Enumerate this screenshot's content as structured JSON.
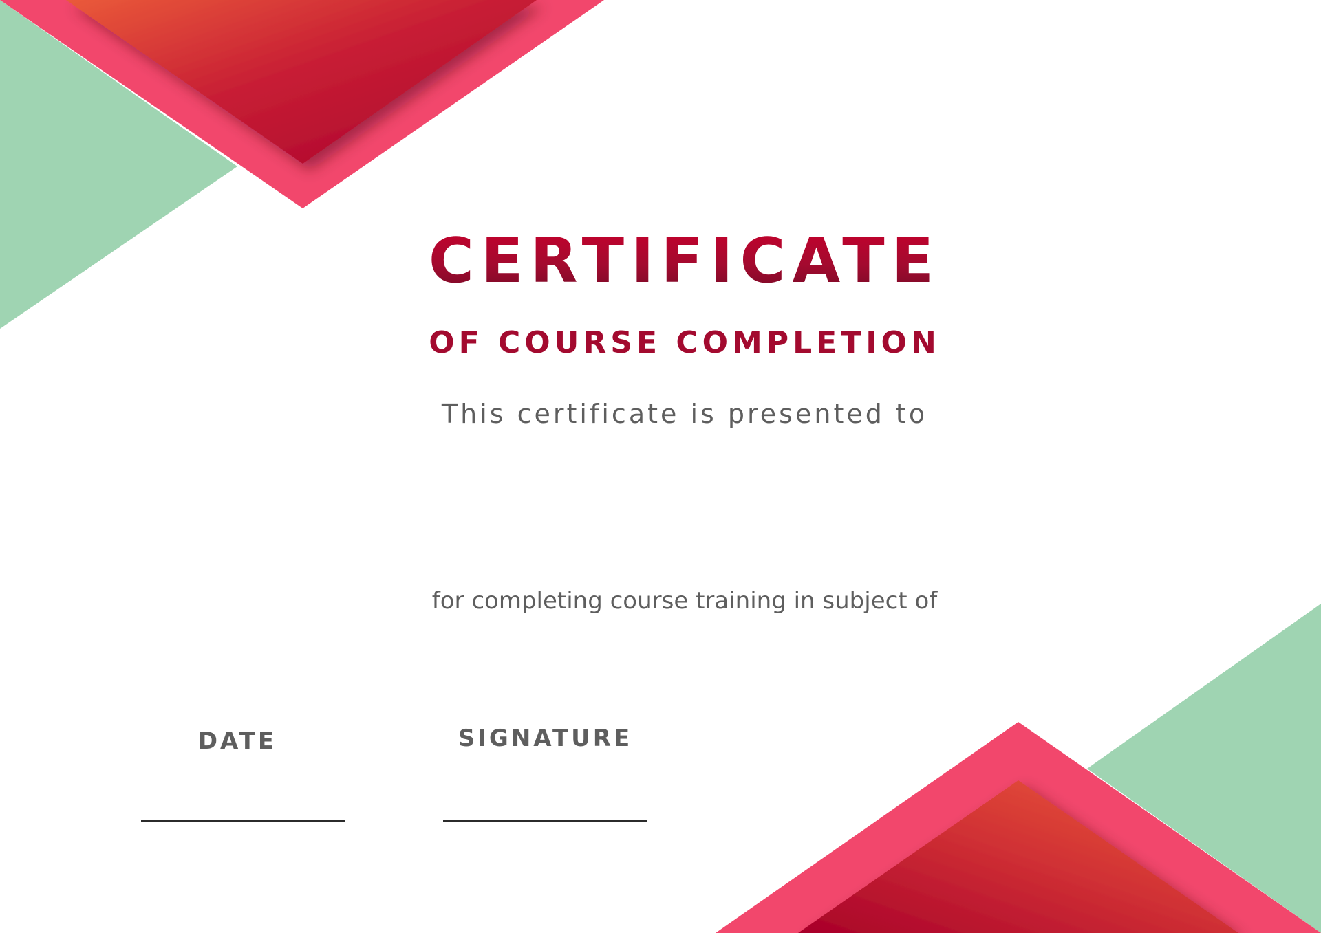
{
  "certificate": {
    "title": "CERTIFICATE",
    "subtitle": "OF COURSE COMPLETION",
    "presented_text": "This certificate is presented to",
    "reason_text": "for completing course training in subject of",
    "date_label": "DATE",
    "signature_label": "SIGNATURE"
  },
  "colors": {
    "title": "#a30a2f",
    "body_text": "#5e5e5e",
    "accent_pink": "#f2476c",
    "accent_green": "#9fd4b2",
    "accent_orange": "#ea5a3a",
    "accent_crimson": "#a8002a",
    "gold": "#efc64a",
    "gold_light": "#fff2b8",
    "sign_line": "#2b2b2b",
    "background": "#ffffff"
  }
}
